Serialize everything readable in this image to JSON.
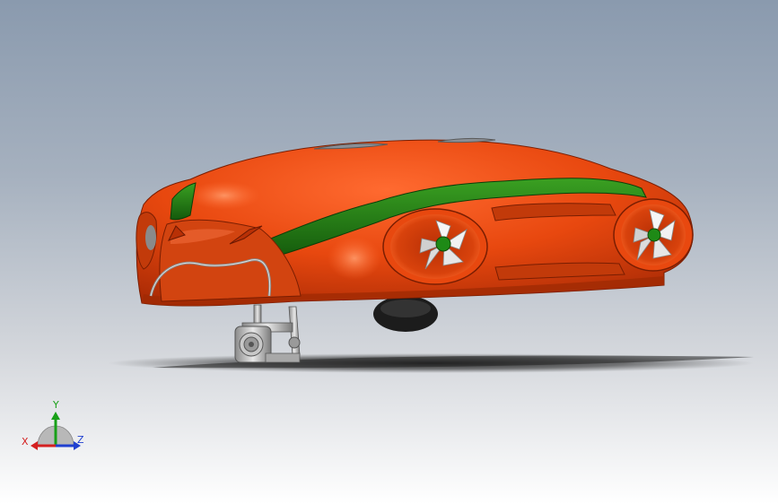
{
  "scene": {
    "background_top": "#8a9aae",
    "background_bottom": "#ffffff",
    "body_color": "#e0440e",
    "stripe_color": "#1f7a14",
    "metal_color": "#b8b8b8"
  },
  "triad": {
    "x_label": "X",
    "y_label": "Y",
    "z_label": "Z",
    "x_color": "#d42020",
    "y_color": "#18a018",
    "z_color": "#2040d0"
  }
}
